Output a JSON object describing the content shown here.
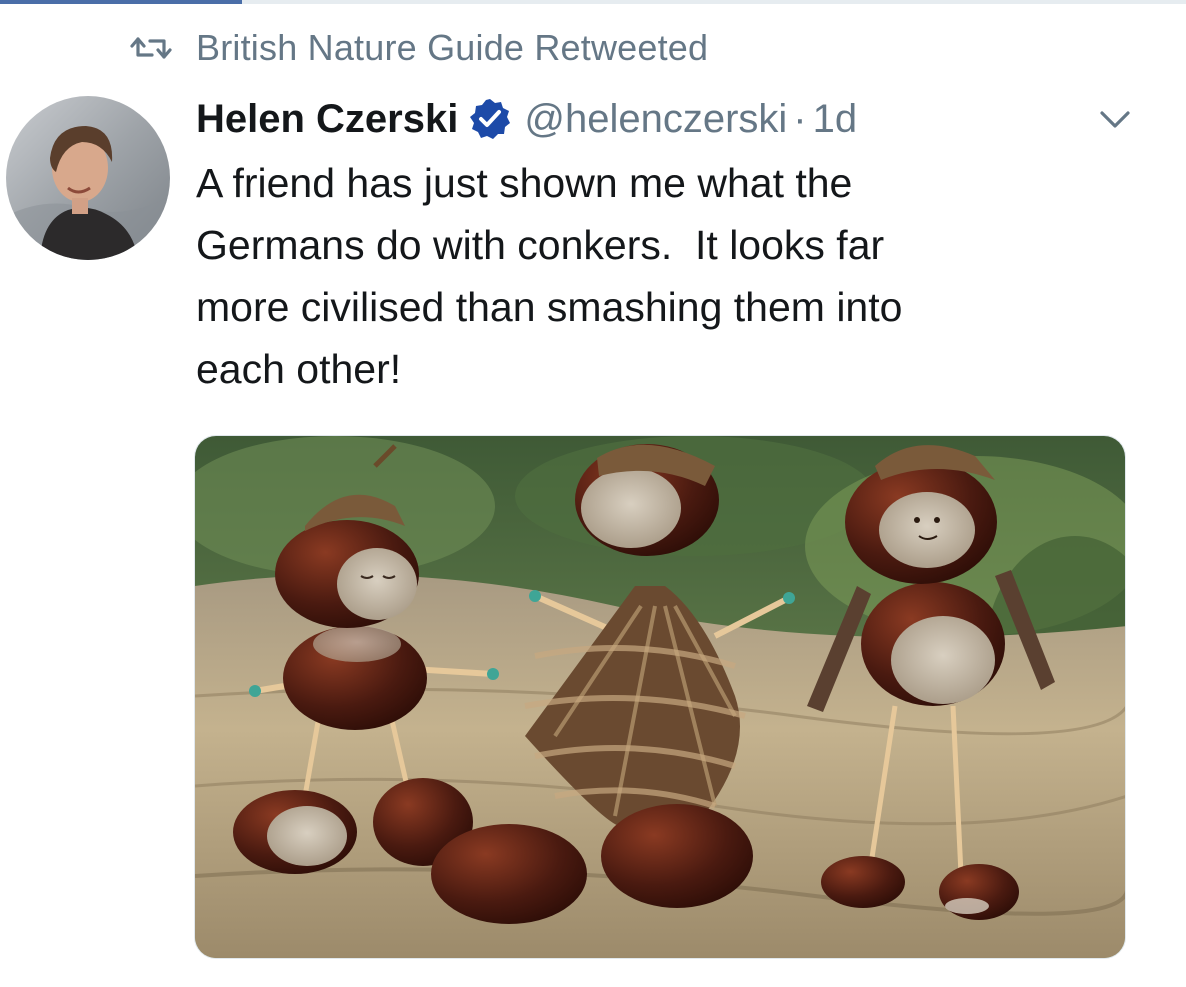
{
  "retweet": {
    "icon": "retweet-icon",
    "label": "British Nature Guide Retweeted"
  },
  "tweet": {
    "author": {
      "display_name": "Helen Czerski",
      "verified": true,
      "verified_icon": "verified-badge-icon",
      "handle": "@helenczerski",
      "separator": "·",
      "time": "1d",
      "avatar_icon": "user-avatar"
    },
    "caret_icon": "chevron-down-icon",
    "text_lines": [
      "A friend has just shown me what the",
      "Germans do with conkers.  It looks far",
      "more civilised than smashing them into",
      "each other!"
    ],
    "media": {
      "icon": "photo-conker-figures"
    }
  },
  "colors": {
    "primary_text": "#14171a",
    "secondary_text": "#657786",
    "verified_blue": "#1d4aa8",
    "accent_rule": "#4a6ea8"
  }
}
